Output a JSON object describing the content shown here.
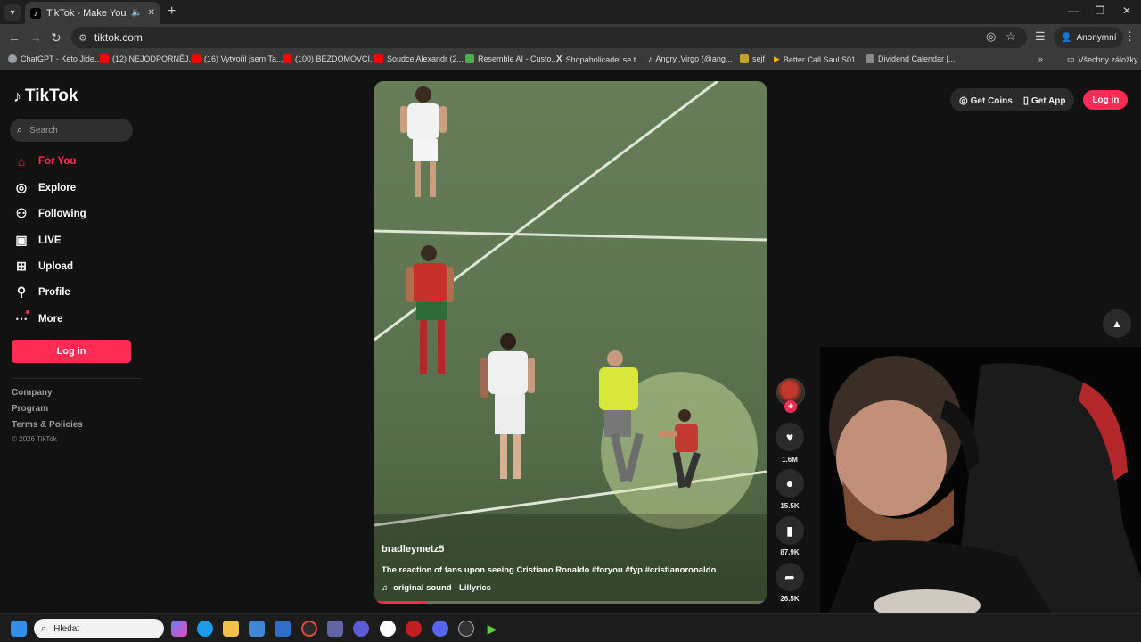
{
  "browser": {
    "tab_title": "TikTok - Make Your Day",
    "tab_favicon": "tiktok-icon",
    "url": "tiktok.com",
    "profile_label": "Anonymní",
    "bookmarks": [
      {
        "label": "ChatGPT - Keto Jide...",
        "icon": "chatgpt-icon",
        "color": "#9aa0a6"
      },
      {
        "label": "(12) NEJODPORNĚJ...",
        "icon": "youtube-icon",
        "color": "#ff0000"
      },
      {
        "label": "(16) Vytvořil jsem Ta...",
        "icon": "youtube-icon",
        "color": "#ff0000"
      },
      {
        "label": "(100) BEZDOMOVCI...",
        "icon": "youtube-icon",
        "color": "#ff0000"
      },
      {
        "label": "Soudce Alexandr (2...",
        "icon": "youtube-icon",
        "color": "#ff0000"
      },
      {
        "label": "Resemble AI - Custo...",
        "icon": "resemble-icon",
        "color": "#4caf50"
      },
      {
        "label": "Shopaholicadel se t...",
        "icon": "x-icon",
        "color": "#ffffff"
      },
      {
        "label": "Angry..Virgo (@ang...",
        "icon": "tiktok-icon",
        "color": "#000000"
      },
      {
        "label": "sejf",
        "icon": "folder-icon",
        "color": "#c9a227"
      },
      {
        "label": "Better Call Saul S01...",
        "icon": "play-icon",
        "color": "#f0b400"
      },
      {
        "label": "Dividend Calendar |...",
        "icon": "tr-icon",
        "color": "#888888"
      }
    ],
    "all_bookmarks_label": "Všechny záložky"
  },
  "sidebar": {
    "brand": "TikTok",
    "search_placeholder": "Search",
    "nav": [
      {
        "label": "For You",
        "icon": "home-icon",
        "active": true
      },
      {
        "label": "Explore",
        "icon": "compass-icon",
        "active": false
      },
      {
        "label": "Following",
        "icon": "following-icon",
        "active": false
      },
      {
        "label": "LIVE",
        "icon": "live-icon",
        "active": false
      },
      {
        "label": "Upload",
        "icon": "upload-icon",
        "active": false
      },
      {
        "label": "Profile",
        "icon": "profile-icon",
        "active": false
      },
      {
        "label": "More",
        "icon": "more-icon",
        "active": false
      }
    ],
    "login_label": "Log in",
    "footer_links": [
      "Company",
      "Program",
      "Terms & Policies"
    ],
    "copyright": "© 2026 TikTok"
  },
  "header": {
    "get_coins": "Get Coins",
    "get_app": "Get App",
    "login": "Log in"
  },
  "video": {
    "username": "bradleymetz5",
    "caption": "The reaction of fans upon seeing Cristiano Ronaldo #foryou #fyp #cristianoronaldo",
    "sound": "original sound - Lillyrics",
    "progress": 0.135
  },
  "actions": {
    "likes": "1.6M",
    "comments": "15.5K",
    "saves": "87.9K",
    "shares": "26.5K"
  },
  "taskbar": {
    "search_placeholder": "Hledat"
  },
  "colors": {
    "accent": "#fe2c55",
    "page_bg": "#121212",
    "chrome_bg": "#3a3a3a"
  }
}
